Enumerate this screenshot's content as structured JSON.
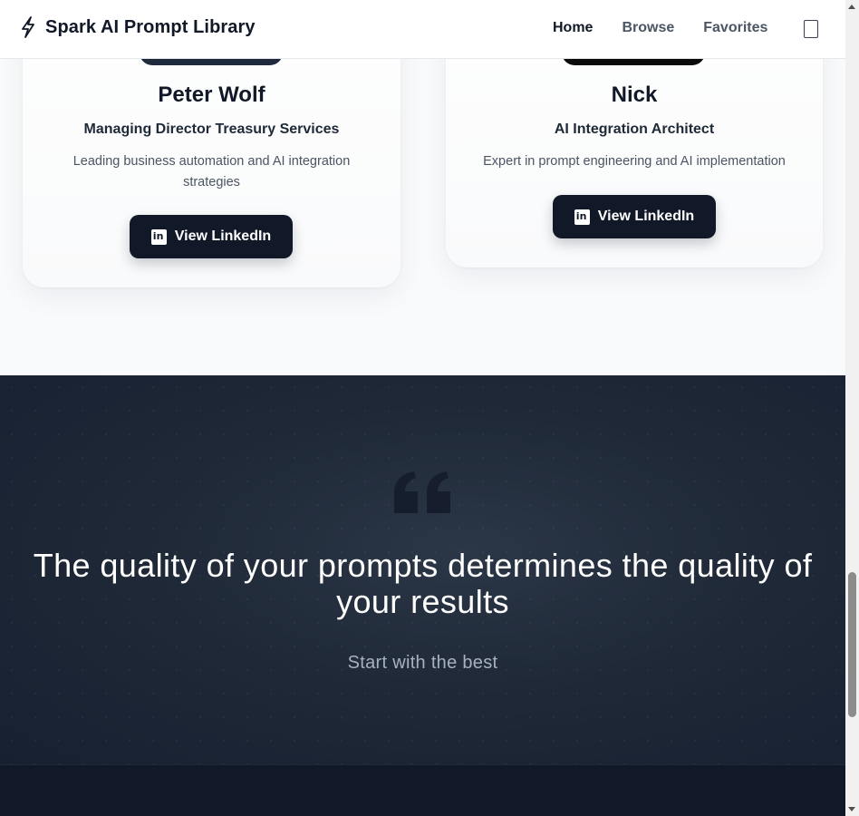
{
  "header": {
    "brand_title": "Spark AI Prompt Library",
    "nav": [
      {
        "label": "Home",
        "active": true
      },
      {
        "label": "Browse",
        "active": false
      },
      {
        "label": "Favorites",
        "active": false
      }
    ]
  },
  "team": [
    {
      "name": "Peter Wolf",
      "role": "Managing Director Treasury Services",
      "description": "Leading business automation and AI integration strategies",
      "button_label": "View LinkedIn"
    },
    {
      "name": "Nick",
      "role": "AI Integration Architect",
      "description": "Expert in prompt engineering and AI implementation",
      "button_label": "View LinkedIn"
    }
  ],
  "quote": {
    "text": "The quality of your prompts determines the quality of your results",
    "subtitle": "Start with the best"
  },
  "colors": {
    "primary": "#111827",
    "quote_bg": "#1f2937",
    "muted_text": "#4b5563"
  }
}
